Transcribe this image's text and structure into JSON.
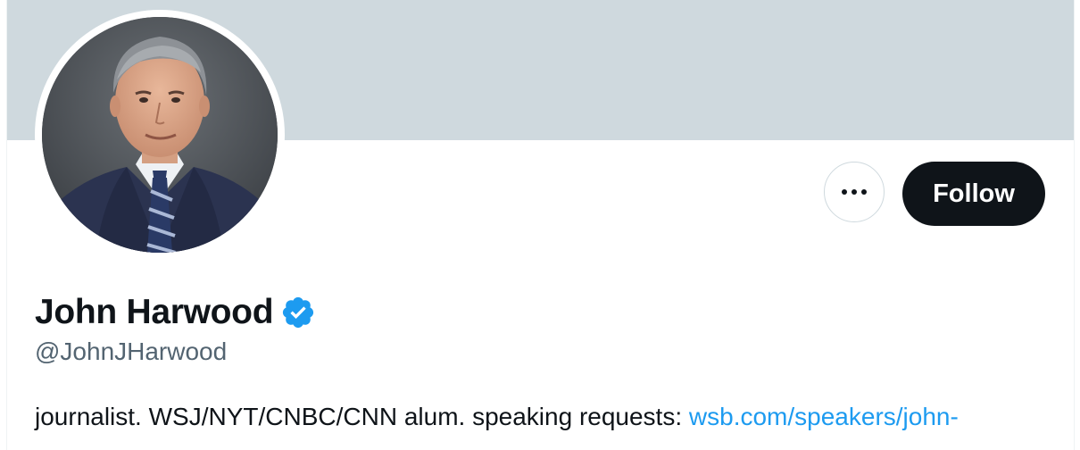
{
  "profile": {
    "display_name": "John Harwood",
    "handle": "@JohnJHarwood",
    "verified": true,
    "bio_text": "journalist. WSJ/NYT/CNBC/CNN alum. speaking requests: ",
    "bio_link": "wsb.com/speakers/john-"
  },
  "actions": {
    "follow_label": "Follow",
    "more_icon": "more-dots-icon"
  },
  "colors": {
    "banner": "#cfd9de",
    "follow_bg": "#0f1419",
    "verified": "#1d9bf0",
    "link": "#1d9bf0",
    "handle": "#536471"
  }
}
